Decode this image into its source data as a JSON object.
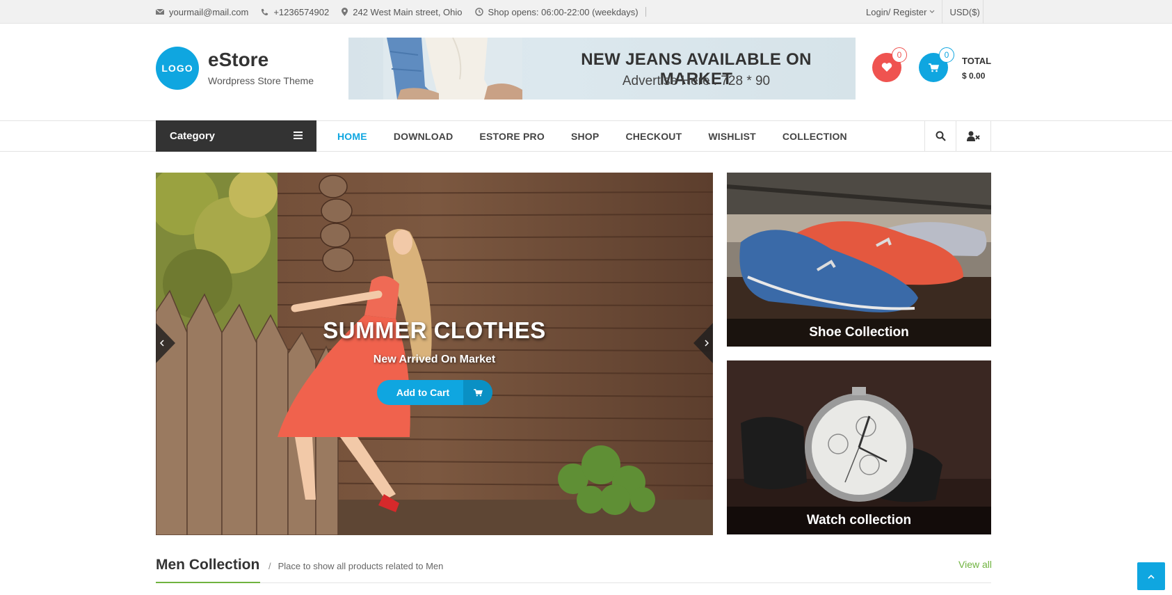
{
  "topbar": {
    "email": "yourmail@mail.com",
    "phone": "+1236574902",
    "address": "242 West Main street, Ohio",
    "hours": "Shop opens: 06:00-22:00 (weekdays)",
    "login": "Login/ Register",
    "currency": "USD($)"
  },
  "header": {
    "logo_text": "LOGO",
    "site_title": "eStore",
    "tagline": "Wordpress Store Theme",
    "banner_title": "NEW JEANS AVAILABLE ON MARKET",
    "banner_sub": "Advertise Here : 728 * 90",
    "wishlist_count": "0",
    "cart_count": "0",
    "total_label": "TOTAL",
    "total_value": "$ 0.00"
  },
  "nav": {
    "category": "Category",
    "items": [
      {
        "label": "HOME",
        "active": true
      },
      {
        "label": "DOWNLOAD"
      },
      {
        "label": "ESTORE PRO"
      },
      {
        "label": "SHOP"
      },
      {
        "label": "CHECKOUT"
      },
      {
        "label": "WISHLIST"
      },
      {
        "label": "COLLECTION"
      }
    ]
  },
  "slider": {
    "title": "SUMMER CLOTHES",
    "subtitle": "New Arrived On Market",
    "button": "Add to Cart"
  },
  "promos": [
    {
      "label": "Shoe Collection"
    },
    {
      "label": "Watch collection"
    }
  ],
  "section": {
    "title": "Men Collection",
    "sep": "/",
    "subtitle": "Place to show all products related to Men",
    "view_all": "View all"
  },
  "colors": {
    "accent": "#0fa6e0",
    "wishlist": "#ef5350",
    "green": "#6fb33f",
    "dark": "#333333"
  }
}
